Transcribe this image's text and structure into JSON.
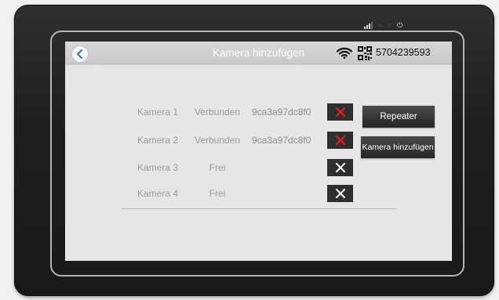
{
  "header": {
    "title": "Kamera hinzufügen",
    "device_id": "5704239593"
  },
  "cameras": [
    {
      "name": "Kamera 1",
      "status": "Verbunden",
      "id": "9ca3a97dc8f0",
      "remove_color": "#e02020"
    },
    {
      "name": "Kamera 2",
      "status": "Verbunden",
      "id": "9ca3a97dc8f0",
      "remove_color": "#e02020"
    },
    {
      "name": "Kamera 3",
      "status": "Frei",
      "id": "",
      "remove_color": "#ffffff"
    },
    {
      "name": "Kamera 4",
      "status": "Frei",
      "id": "",
      "remove_color": "#ffffff"
    }
  ],
  "actions": {
    "repeater_label": "Repeater",
    "add_camera_label": "Kamera hinzufügen"
  }
}
